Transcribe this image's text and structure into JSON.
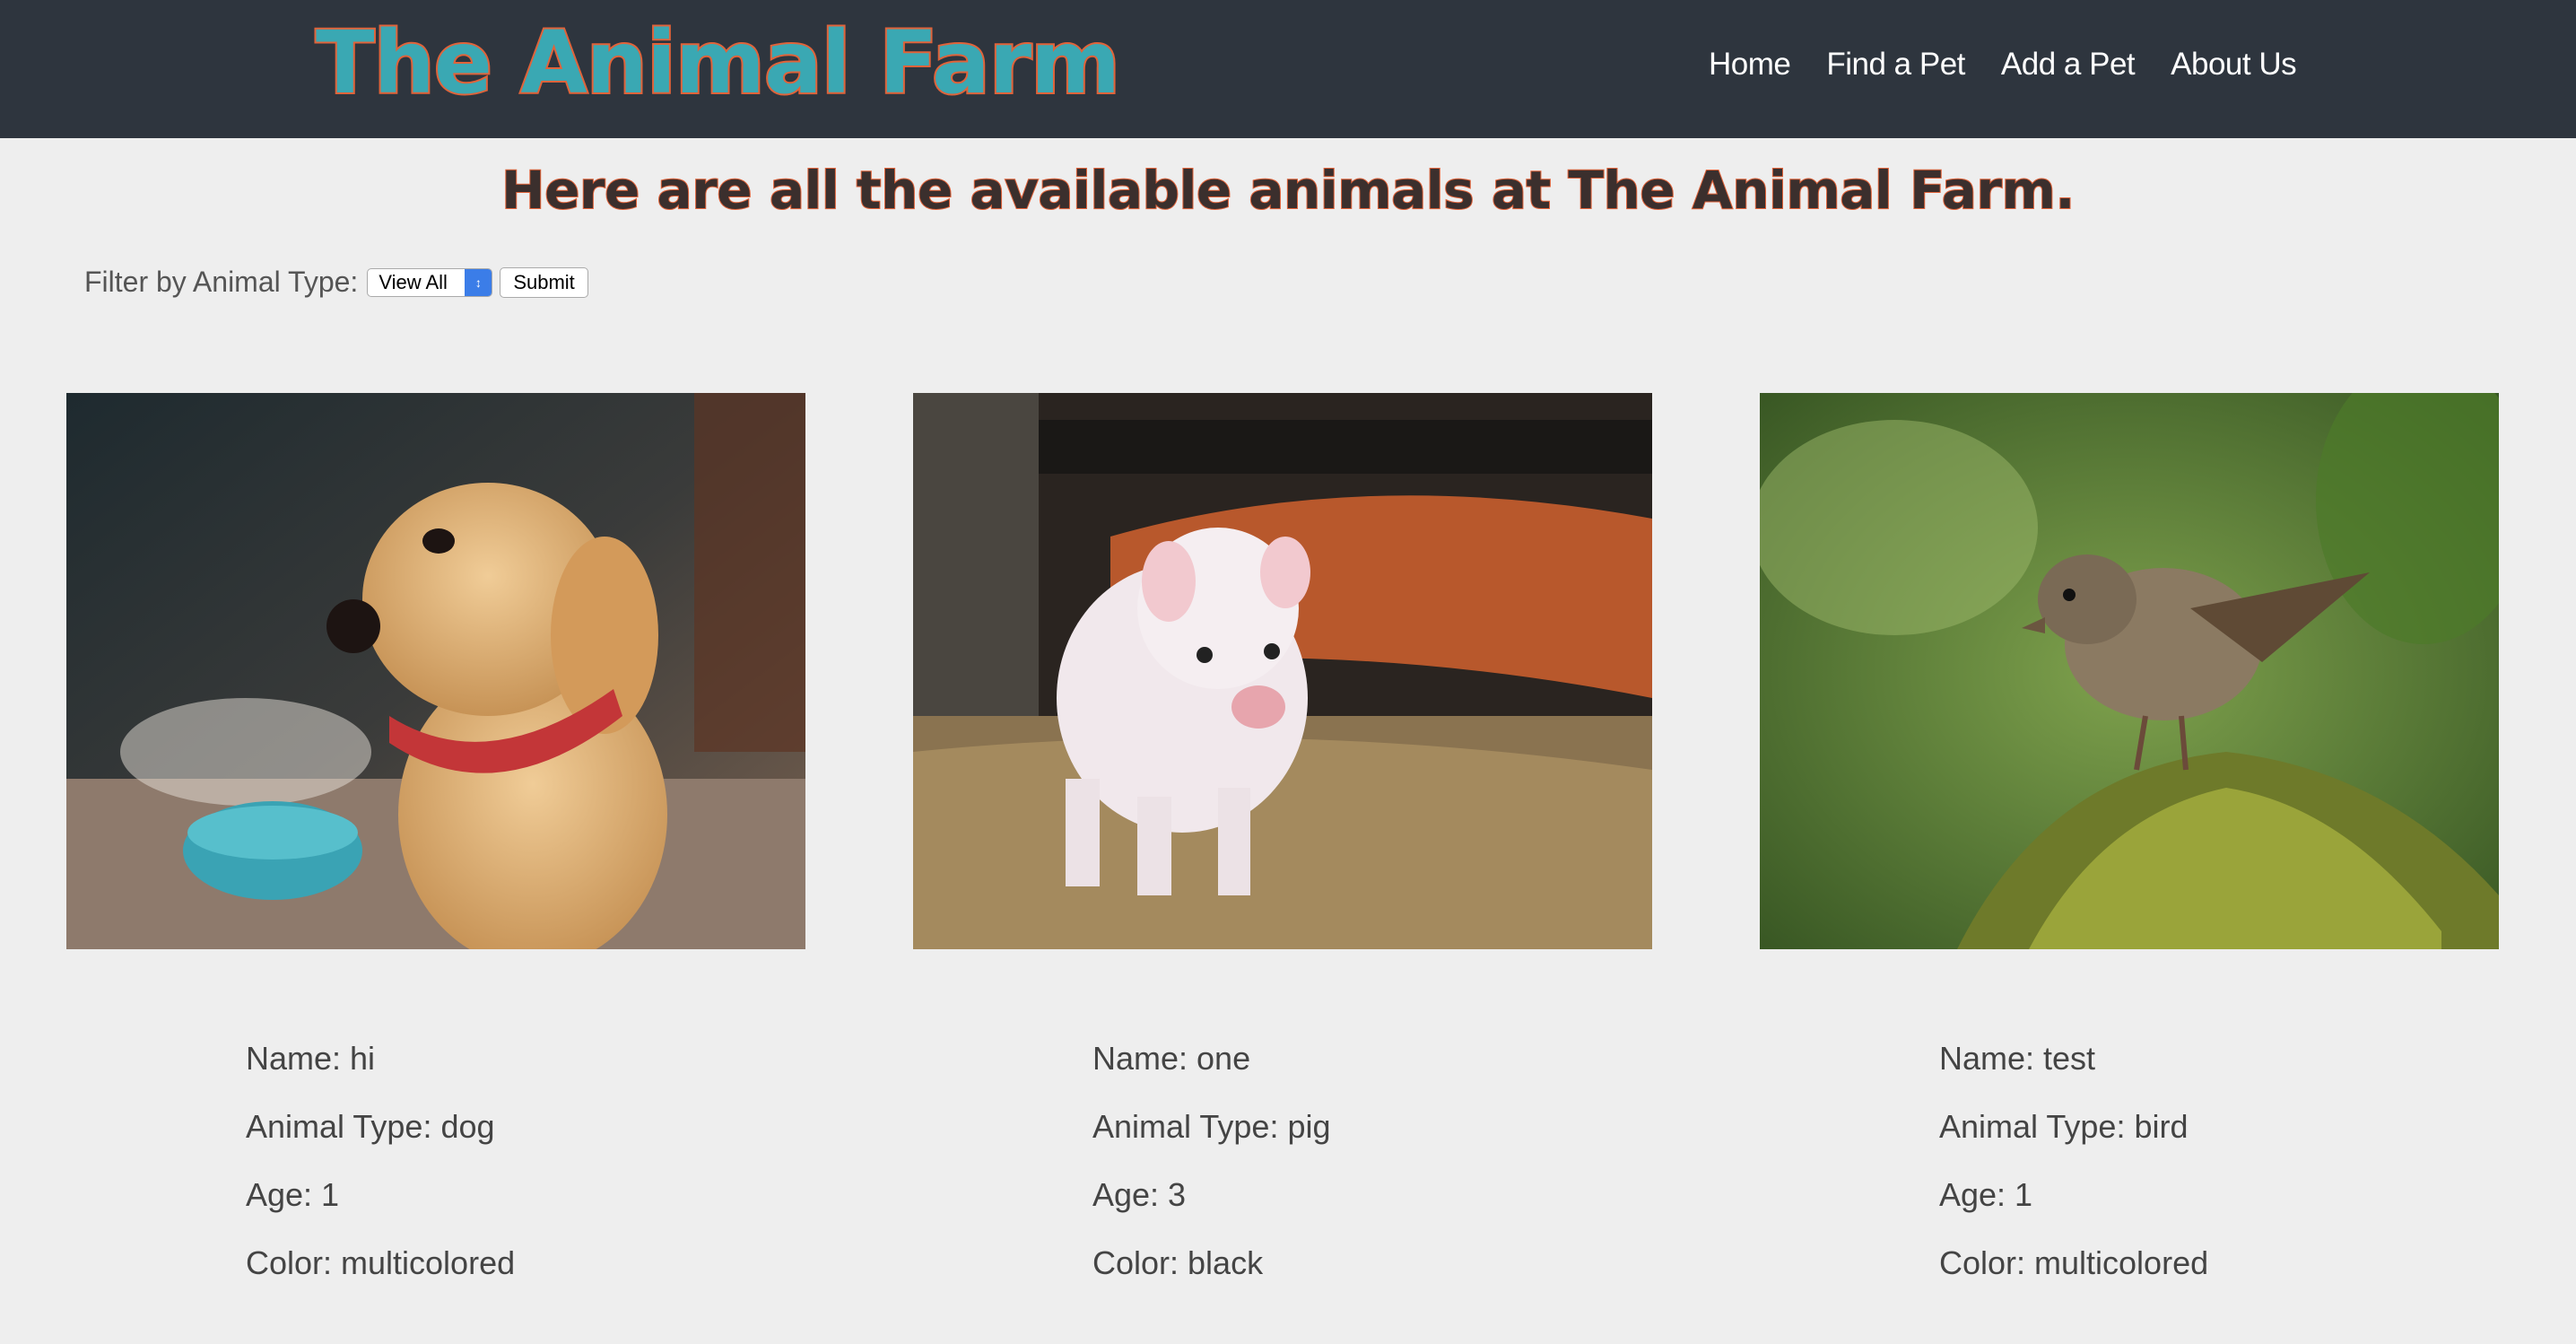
{
  "header": {
    "brand": "The Animal Farm",
    "nav": [
      "Home",
      "Find a Pet",
      "Add a Pet",
      "About Us"
    ]
  },
  "main": {
    "title": "Here are all the available animals at The Animal Farm.",
    "filter": {
      "label": "Filter by Animal Type:",
      "selected": "View All",
      "submit": "Submit"
    },
    "animals": [
      {
        "name": "Name: hi",
        "type": "Animal Type: dog",
        "age": "Age: 1",
        "color": "Color: multicolored",
        "photo": "puppy-photo"
      },
      {
        "name": "Name: one",
        "type": "Animal Type: pig",
        "age": "Age: 3",
        "color": "Color: black",
        "photo": "piglet-photo"
      },
      {
        "name": "Name: test",
        "type": "Animal Type: bird",
        "age": "Age: 1",
        "color": "Color: multicolored",
        "photo": "sparrow-photo"
      }
    ]
  },
  "colors": {
    "navbar": "#2e353e",
    "brand_fill": "#3aa8b3",
    "brand_stroke": "#e0633a",
    "background": "#eeeeee",
    "select_accent": "#3b7de8"
  }
}
